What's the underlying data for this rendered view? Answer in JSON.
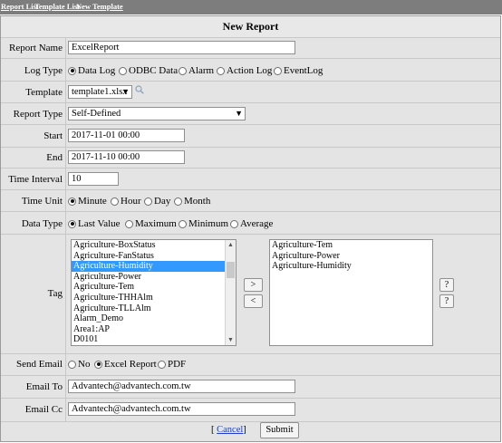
{
  "nav": {
    "links": [
      "Report List",
      "Template List",
      "New Template"
    ]
  },
  "form": {
    "title": "New Report",
    "report_name": {
      "label": "Report Name",
      "value": "ExcelReport"
    },
    "log_type": {
      "label": "Log Type",
      "options": [
        "Data Log",
        "ODBC Data",
        "Alarm",
        "Action Log",
        "EventLog"
      ],
      "selected": "Data Log"
    },
    "template": {
      "label": "Template",
      "value": "template1.xlsx"
    },
    "report_type": {
      "label": "Report Type",
      "value": "Self-Defined"
    },
    "start": {
      "label": "Start",
      "value": "2017-11-01 00:00"
    },
    "end": {
      "label": "End",
      "value": "2017-11-10 00:00"
    },
    "time_interval": {
      "label": "Time Interval",
      "value": "10"
    },
    "time_unit": {
      "label": "Time Unit",
      "options": [
        "Minute",
        "Hour",
        "Day",
        "Month"
      ],
      "selected": "Minute"
    },
    "data_type": {
      "label": "Data Type",
      "options": [
        "Last Value",
        "Maximum",
        "Minimum",
        "Average"
      ],
      "selected": "Last Value"
    },
    "tag": {
      "label": "Tag",
      "available": [
        "Agriculture-BoxStatus",
        "Agriculture-FanStatus",
        "Agriculture-Humidity",
        "Agriculture-Power",
        "Agriculture-Tem",
        "Agriculture-THHAlm",
        "Agriculture-TLLAlm",
        "Alarm_Demo",
        "Area1:AP",
        "D0101"
      ],
      "highlighted": "Agriculture-Humidity",
      "selected_tags": [
        "Agriculture-Tem",
        "Agriculture-Power",
        "Agriculture-Humidity"
      ],
      "add_label": ">",
      "remove_label": "<",
      "help_label": "?"
    },
    "send_email": {
      "label": "Send Email",
      "options": [
        "No",
        "Excel Report",
        "PDF"
      ],
      "selected": "Excel Report"
    },
    "email_to": {
      "label": "Email To",
      "value": "Advantech@advantech.com.tw"
    },
    "email_cc": {
      "label": "Email Cc",
      "value": "Advantech@advantech.com.tw"
    },
    "cancel_label": "Cancel",
    "submit_label": "Submit"
  },
  "colors": {
    "nav_bg": "#7d7d7d",
    "panel_bg": "#e4e4e4",
    "selection": "#3399ff",
    "link": "#1a3fd1"
  },
  "icons": {
    "template_search": "search-icon"
  }
}
